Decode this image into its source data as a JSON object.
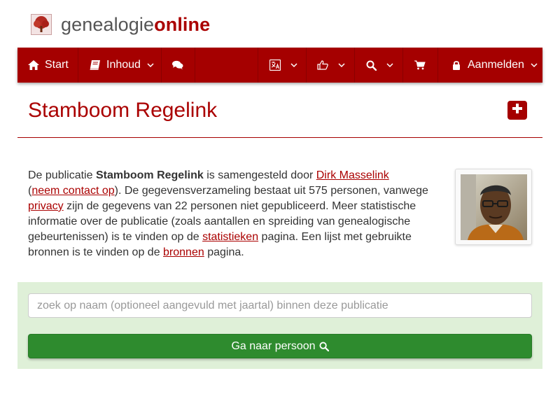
{
  "logo": {
    "part1": "genealogie",
    "part2": "online",
    "icon": "tree-logo-icon"
  },
  "nav": {
    "start": "Start",
    "inhoud": "Inhoud",
    "aanmelden": "Aanmelden"
  },
  "page": {
    "title": "Stamboom Regelink"
  },
  "intro": {
    "t1": "De publicatie ",
    "pub_name": "Stamboom Regelink",
    "t2": " is samengesteld door ",
    "author_link": "Dirk Masselink",
    "t3": "(",
    "contact_link": "neem contact op",
    "t4": "). De gegevensverzameling bestaat uit 575 personen, vanwege ",
    "privacy_link": "privacy",
    "t5": " zijn de gegevens van 22 personen niet gepubliceerd. Meer statistische informatie over de publicatie (zoals aantallen en spreiding van genealogische gebeurtenissen) is te vinden op de ",
    "stats_link": "statistieken",
    "t6": " pagina. Een lijst met gebruikte bronnen is te vinden op de ",
    "sources_link": "bronnen",
    "t7": " pagina."
  },
  "search": {
    "placeholder": "zoek op naam (optioneel aangevuld met jaartal) binnen deze publicatie",
    "button_label": "Ga naar persoon"
  },
  "colors": {
    "brand": "#a50000",
    "accent_green": "#2e8b2e",
    "panel_green": "#dff0d8"
  }
}
